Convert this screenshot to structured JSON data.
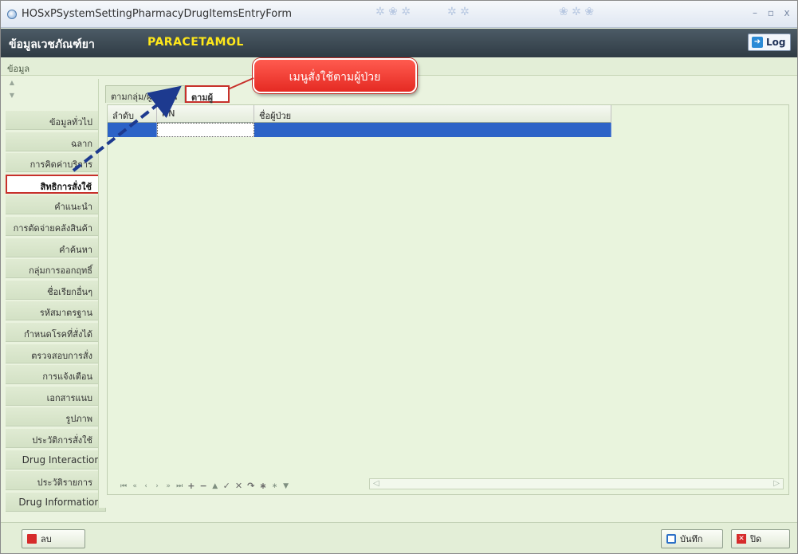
{
  "window": {
    "title": "HOSxPSystemSettingPharmacyDrugItemsEntryForm"
  },
  "header": {
    "caption": "ข้อมูลเวชภัณฑ์ยา",
    "drug_name": "PARACETAMOL",
    "log_label": "Log"
  },
  "subbar": {
    "label": "ข้อมูล"
  },
  "sidebar": {
    "items": [
      {
        "label": "ข้อมูลทั่วไป"
      },
      {
        "label": "ฉลาก"
      },
      {
        "label": "การคิดค่าบริการ"
      },
      {
        "label": "สิทธิการสั่งใช้"
      },
      {
        "label": "คำแนะนำ"
      },
      {
        "label": "การตัดจ่ายคลังสินค้า"
      },
      {
        "label": "คำค้นหา"
      },
      {
        "label": "กลุ่มการออกฤทธิ์"
      },
      {
        "label": "ชื่อเรียกอื่นๆ"
      },
      {
        "label": "รหัสมาตรฐาน"
      },
      {
        "label": "กำหนดโรคที่สั่งได้"
      },
      {
        "label": "ตรวจสอบการสั่ง"
      },
      {
        "label": "การแจ้งเตือน"
      },
      {
        "label": "เอกสารแนบ"
      },
      {
        "label": "รูปภาพ"
      },
      {
        "label": "ประวัติการสั่งใช้"
      },
      {
        "label": "Drug Interaction"
      },
      {
        "label": "ประวัติรายการ"
      },
      {
        "label": "Drug Information"
      }
    ],
    "selected_index": 3
  },
  "tabs": [
    {
      "label": "ตามกลุ่ม/ผู้ใช้งาน"
    },
    {
      "label": "ตามผู้ป่วย"
    }
  ],
  "grid": {
    "columns": [
      "ลำดับ",
      "HN",
      "ชื่อผู้ป่วย"
    ]
  },
  "callout": {
    "text": "เมนูสั่งใช้ตามผู้ป่วย"
  },
  "footer": {
    "delete_label": "ลบ",
    "save_label": "บันทึก",
    "close_label": "ปิด"
  },
  "colors": {
    "header_bg": "#3a4650",
    "drug_name": "#ffe81a",
    "selection": "#2c63c7",
    "highlight_border": "#c7302b",
    "panel_bg": "#eaf3df"
  }
}
